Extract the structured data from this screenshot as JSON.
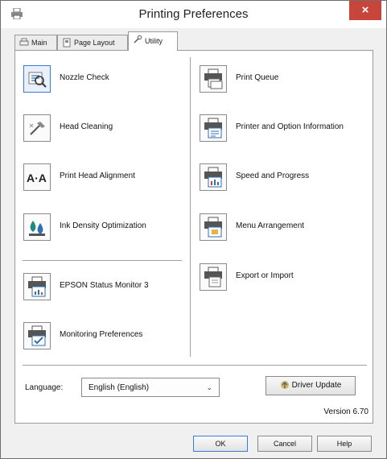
{
  "window": {
    "title": "Printing Preferences",
    "close": "×"
  },
  "tabs": [
    {
      "label": "Main"
    },
    {
      "label": "Page Layout"
    },
    {
      "label": "Utility"
    }
  ],
  "left_items": [
    {
      "label": "Nozzle Check",
      "icon": "nozzle-check-icon"
    },
    {
      "label": "Head Cleaning",
      "icon": "head-cleaning-icon"
    },
    {
      "label": "Print Head Alignment",
      "icon": "head-alignment-icon",
      "glyph": "A·A"
    },
    {
      "label": "Ink Density Optimization",
      "icon": "ink-density-icon"
    },
    {
      "label": "EPSON Status Monitor 3",
      "icon": "status-monitor-icon"
    },
    {
      "label": "Monitoring Preferences",
      "icon": "monitoring-preferences-icon"
    }
  ],
  "right_items": [
    {
      "label": "Print Queue",
      "icon": "print-queue-icon"
    },
    {
      "label": "Printer and Option Information",
      "icon": "printer-info-icon"
    },
    {
      "label": "Speed and Progress",
      "icon": "speed-progress-icon"
    },
    {
      "label": "Menu Arrangement",
      "icon": "menu-arrangement-icon"
    },
    {
      "label": "Export or Import",
      "icon": "export-import-icon"
    }
  ],
  "language": {
    "label": "Language:",
    "value": "English (English)",
    "chevron": "⌄"
  },
  "driver_update": {
    "label": "Driver Update"
  },
  "version": "Version 6.70",
  "buttons": {
    "ok": "OK",
    "cancel": "Cancel",
    "help": "Help"
  },
  "colors": {
    "close_red": "#c7453b",
    "focus_blue": "#3a7bd5",
    "ink_blue": "#2f6fb5"
  }
}
